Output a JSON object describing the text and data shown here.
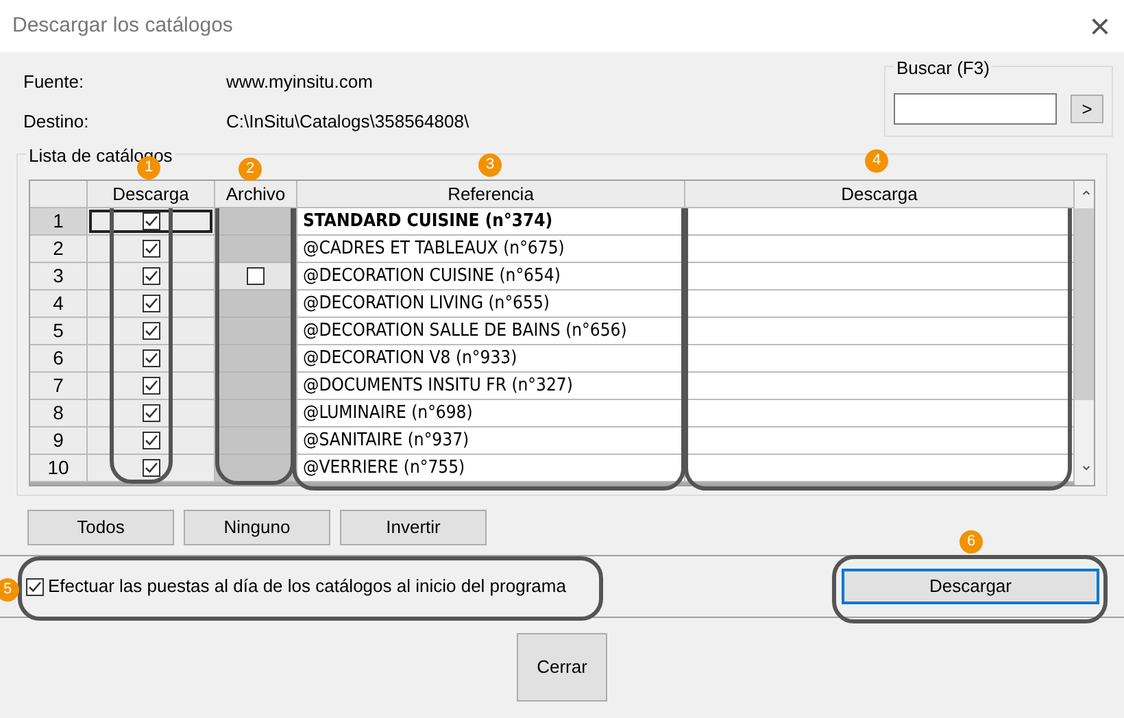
{
  "window": {
    "title": "Descargar los catálogos",
    "close": "×"
  },
  "info": [
    {
      "label": "Fuente:",
      "value": "www.myinsitu.com"
    },
    {
      "label": "Destino:",
      "value": "C:\\InSitu\\Catalogs\\358564808\\"
    }
  ],
  "search": {
    "title": "Buscar (F3)",
    "button": ">"
  },
  "list": {
    "title": "Lista de catálogos",
    "columns": [
      "Descarga",
      "Archivo",
      "Referencia",
      "Descarga"
    ],
    "scroll_up": "⌃",
    "scroll_down": "⌄",
    "rows": [
      {
        "number": "1",
        "selected": true,
        "download": true,
        "archivo": {
          "kind": "empty"
        },
        "reference": "STANDARD CUISINE (n°374)"
      },
      {
        "number": "2",
        "selected": false,
        "download": true,
        "archivo": {
          "kind": "empty"
        },
        "reference": "@CADRES ET TABLEAUX (n°675)"
      },
      {
        "number": "3",
        "selected": false,
        "download": true,
        "archivo": {
          "kind": "checkbox",
          "checked": false
        },
        "reference": "@DECORATION CUISINE (n°654)"
      },
      {
        "number": "4",
        "selected": false,
        "download": true,
        "archivo": {
          "kind": "empty"
        },
        "reference": "@DECORATION LIVING (n°655)"
      },
      {
        "number": "5",
        "selected": false,
        "download": true,
        "archivo": {
          "kind": "empty"
        },
        "reference": "@DECORATION SALLE DE BAINS (n°656)"
      },
      {
        "number": "6",
        "selected": false,
        "download": true,
        "archivo": {
          "kind": "empty"
        },
        "reference": "@DECORATION V8 (n°933)"
      },
      {
        "number": "7",
        "selected": false,
        "download": true,
        "archivo": {
          "kind": "empty"
        },
        "reference": "@DOCUMENTS INSITU FR (n°327)"
      },
      {
        "number": "8",
        "selected": false,
        "download": true,
        "archivo": {
          "kind": "empty"
        },
        "reference": "@LUMINAIRE (n°698)"
      },
      {
        "number": "9",
        "selected": false,
        "download": true,
        "archivo": {
          "kind": "empty"
        },
        "reference": "@SANITAIRE (n°937)"
      },
      {
        "number": "10",
        "selected": false,
        "download": true,
        "archivo": {
          "kind": "empty"
        },
        "reference": "@VERRIERE (n°755)"
      }
    ]
  },
  "selection_buttons": [
    "Todos",
    "Ninguno",
    "Invertir"
  ],
  "auto_update": {
    "label": "Efectuar las puestas al día de los catálogos al inicio del programa",
    "checked": true
  },
  "download_button": "Descargar",
  "close_button": "Cerrar",
  "callouts": [
    "1",
    "2",
    "3",
    "4",
    "5",
    "6"
  ]
}
